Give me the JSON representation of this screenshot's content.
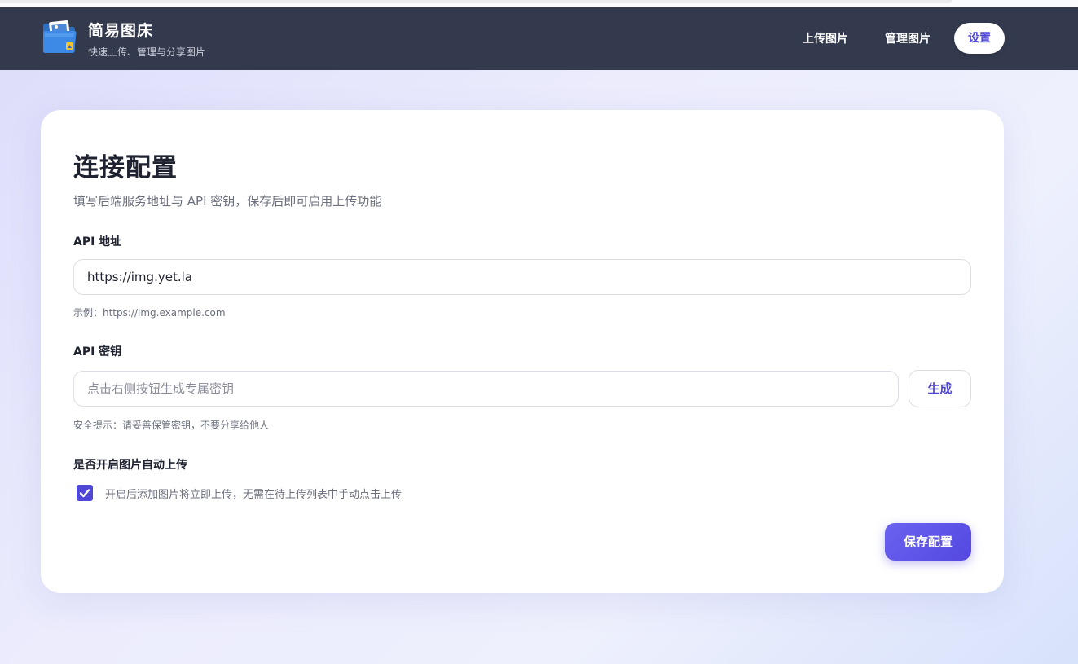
{
  "header": {
    "title": "简易图床",
    "subtitle": "快速上传、管理与分享图片",
    "nav": {
      "upload": "上传图片",
      "manage": "管理图片",
      "settings": "设置"
    }
  },
  "card": {
    "title": "连接配置",
    "description": "填写后端服务地址与 API 密钥，保存后即可启用上传功能",
    "api_url": {
      "label": "API 地址",
      "value": "https://img.yet.la",
      "hint": "示例：https://img.example.com"
    },
    "api_key": {
      "label": "API 密钥",
      "placeholder": "点击右侧按钮生成专属密钥",
      "generate_label": "生成",
      "hint": "安全提示：请妥善保管密钥，不要分享给他人"
    },
    "auto_upload": {
      "label": "是否开启图片自动上传",
      "checked": true,
      "description": "开启后添加图片将立即上传，无需在待上传列表中手动点击上传"
    },
    "save_label": "保存配置"
  },
  "colors": {
    "header_bg": "#343a4e",
    "accent": "#4f47d6"
  },
  "icons": {
    "logo": "folder-image-icon",
    "checkbox": "checkmark-icon"
  }
}
